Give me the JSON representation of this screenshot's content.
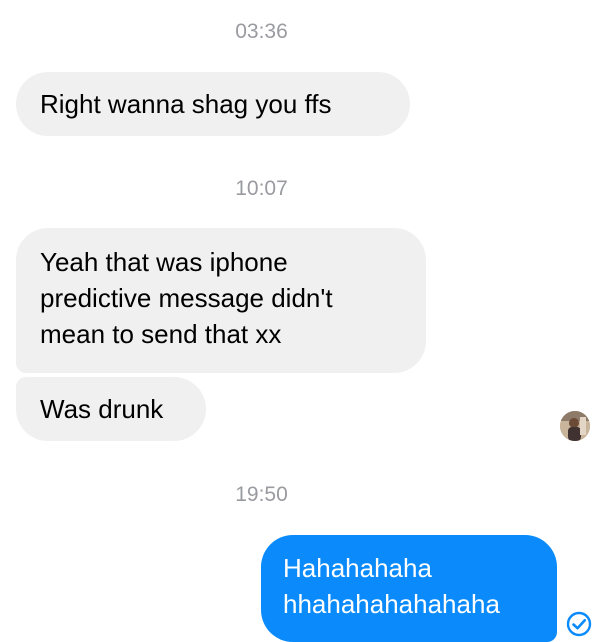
{
  "thread": [
    {
      "type": "timestamp",
      "text": "03:36"
    },
    {
      "type": "message",
      "direction": "incoming",
      "lines": [
        "Right wanna shag you ffs"
      ]
    },
    {
      "type": "timestamp",
      "text": "10:07"
    },
    {
      "type": "message",
      "direction": "incoming",
      "lines": [
        "Yeah that was iphone",
        "predictive message didn't",
        "mean to send that xx"
      ]
    },
    {
      "type": "message",
      "direction": "incoming",
      "lines": [
        "Was drunk"
      ]
    },
    {
      "type": "timestamp",
      "text": "19:50"
    },
    {
      "type": "message",
      "direction": "outgoing",
      "lines": [
        "Hahahahaha",
        "hhahahahahahaha"
      ]
    }
  ],
  "colors": {
    "incoming_bubble": "#f1f0f0",
    "outgoing_bubble": "#0b8bfb",
    "timestamp_text": "#9a9ba0",
    "seen_check": "#0b8bfb"
  },
  "icons": {
    "contact_avatar": "avatar",
    "read_receipt": "check-circle-icon"
  }
}
